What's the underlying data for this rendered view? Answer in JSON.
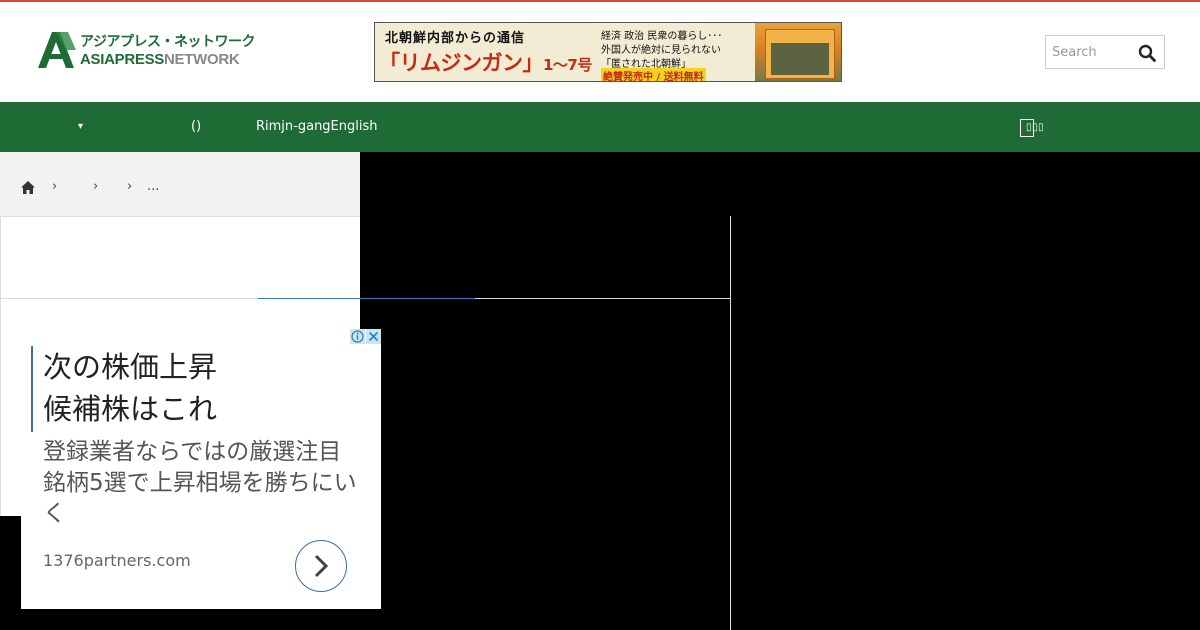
{
  "header": {
    "logo_ja": "アジアプレス・ネットワーク",
    "logo_en_part1": "ASIAPRESS",
    "logo_en_part2": "NETWORK",
    "logo_icon": "asiapress-a-logo",
    "search_placeholder": "Search",
    "search_icon": "search-icon"
  },
  "banner": {
    "top_text": "北朝鮮内部からの通信",
    "title": "「リムジンガン」",
    "issue": "1〜7号",
    "line1": "経済 政治 民衆の暮らし･･･",
    "line2": "外国人が絶対に見られない",
    "line3": "「匿された北朝鮮」",
    "line4": "絶賛発売中 / 送料無料"
  },
  "nav": {
    "caret": "▾",
    "paren": "()",
    "rimjin": "Rimjn-gangEnglish",
    "right_text": "▯▯▯"
  },
  "breadcrumb": {
    "home_icon": "home-icon",
    "sep": "›",
    "ellipsis": "..."
  },
  "ad": {
    "headline_line1": "次の株価上昇",
    "headline_line2": "候補株はこれ",
    "body": "登録業者ならではの厳選注目銘柄5選で上昇相場を勝ちにいく",
    "domain": "1376partners.com",
    "info_icon": "adchoices-info-icon",
    "close_icon": "close-icon",
    "arrow_icon": "chevron-right-icon"
  },
  "colors": {
    "brand_green": "#1e6b35",
    "top_line_red": "#d94a3d",
    "ad_accent_blue": "#3b6fa4"
  }
}
